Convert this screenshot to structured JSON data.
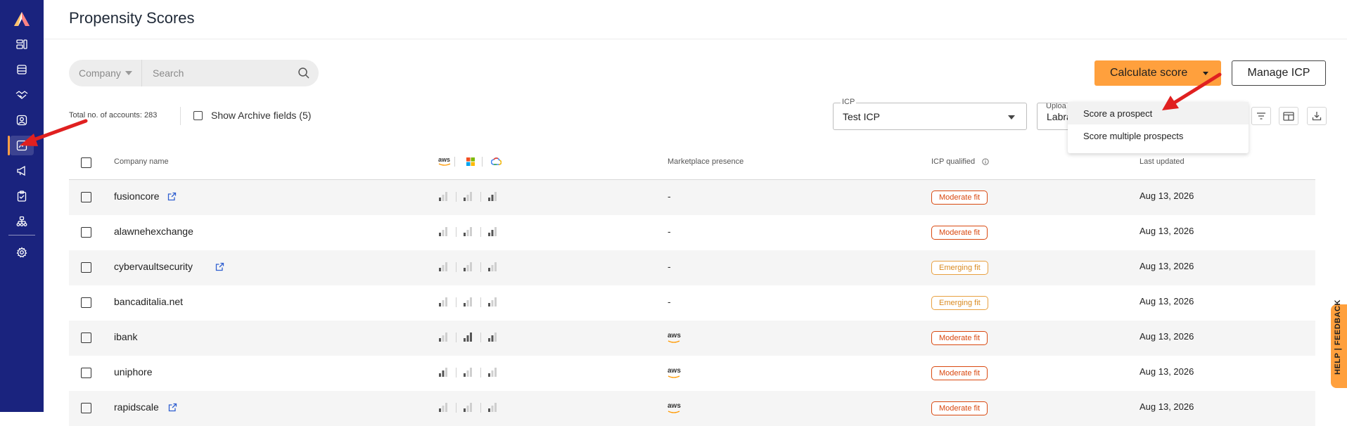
{
  "page": {
    "title": "Propensity Scores"
  },
  "sidebar": {
    "items": [
      {
        "icon": "dashboard-icon"
      },
      {
        "icon": "database-icon"
      },
      {
        "icon": "handshake-icon"
      },
      {
        "icon": "user-icon"
      },
      {
        "icon": "chart-line-icon",
        "active": true
      },
      {
        "icon": "megaphone-icon"
      },
      {
        "icon": "clipboard-check-icon"
      },
      {
        "icon": "org-chart-icon"
      },
      {
        "icon": "gear-icon"
      }
    ]
  },
  "search": {
    "filter_label": "Company",
    "placeholder": "Search"
  },
  "actions": {
    "calculate_label": "Calculate score",
    "manage_icp_label": "Manage ICP"
  },
  "toolbar": {
    "total_accounts": "Total no. of accounts: 283",
    "archive_label": "Show Archive fields (5)",
    "icp_legend": "ICP",
    "icp_value": "Test ICP",
    "upload_legend": "Uploa",
    "upload_value": "Labra"
  },
  "dropdown": {
    "items": [
      "Score a prospect",
      "Score multiple prospects"
    ]
  },
  "table": {
    "headers": {
      "company": "Company name",
      "cloud_aws": "aws",
      "marketplace": "Marketplace presence",
      "icp_qualified": "ICP qualified",
      "last_updated": "Last updated"
    },
    "rows": [
      {
        "name": "fusioncore",
        "link": true,
        "marketplace": "-",
        "fit": "Moderate fit",
        "fit_type": "moderate",
        "date": "Aug 13, 2026",
        "signals": [
          1,
          1,
          2
        ]
      },
      {
        "name": "alawnehexchange",
        "link": false,
        "marketplace": "-",
        "fit": "Moderate fit",
        "fit_type": "moderate",
        "date": "Aug 13, 2026",
        "signals": [
          1,
          1,
          2
        ]
      },
      {
        "name": "cybervaultsecurity",
        "link": true,
        "marketplace": "-",
        "fit": "Emerging fit",
        "fit_type": "emerging",
        "date": "Aug 13, 2026",
        "signals": [
          1,
          1,
          1
        ]
      },
      {
        "name": "bancaditalia.net",
        "link": false,
        "marketplace": "-",
        "fit": "Emerging fit",
        "fit_type": "emerging",
        "date": "Aug 13, 2026",
        "signals": [
          1,
          1,
          1
        ]
      },
      {
        "name": "ibank",
        "link": false,
        "marketplace": "aws",
        "fit": "Moderate fit",
        "fit_type": "moderate",
        "date": "Aug 13, 2026",
        "signals": [
          1,
          3,
          2
        ]
      },
      {
        "name": "uniphore",
        "link": false,
        "marketplace": "aws",
        "fit": "Moderate fit",
        "fit_type": "moderate",
        "date": "Aug 13, 2026",
        "signals": [
          2,
          1,
          1
        ]
      },
      {
        "name": "rapidscale",
        "link": true,
        "marketplace": "aws",
        "fit": "Moderate fit",
        "fit_type": "moderate",
        "date": "Aug 13, 2026",
        "signals": [
          1,
          1,
          1
        ]
      }
    ]
  },
  "feedback": {
    "label": "HELP | FEEDBACK"
  },
  "colors": {
    "sidebar": "#1a237e",
    "accent": "#ffa03d",
    "moderate": "#d9480f",
    "emerging": "#e8a040",
    "arrow": "#e02020"
  }
}
